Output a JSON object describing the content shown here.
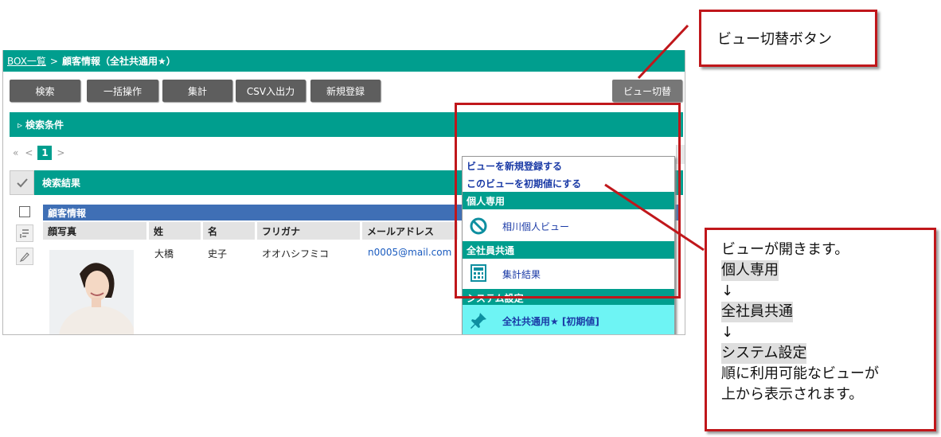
{
  "breadcrumb": {
    "link": "BOX一覧",
    "separator": ">",
    "current": "顧客情報（全社共通用★）"
  },
  "toolbar": {
    "search": "検索",
    "bulk": "一括操作",
    "aggregate": "集計",
    "csv": "CSV入出力",
    "new": "新規登録",
    "view_switch": "ビュー切替"
  },
  "search_conditions": {
    "arrow": "▹",
    "label": "検索条件"
  },
  "pager": {
    "first": "«",
    "prev": "<",
    "current": "1",
    "next": ">"
  },
  "results": {
    "label": "検索結果"
  },
  "table": {
    "group_label": "顧客情報",
    "columns": [
      "顔写真",
      "姓",
      "名",
      "フリガナ",
      "メールアドレス"
    ],
    "rows": [
      {
        "last_name": "大橋",
        "first_name": "史子",
        "kana": "オオハシフミコ",
        "email": "n0005@mail.com"
      }
    ]
  },
  "view_dropdown": {
    "link_new": "ビューを新規登録する",
    "link_default": "このビューを初期値にする",
    "groups": [
      {
        "label": "個人専用",
        "item": "相川個人ビュー",
        "icon": "prohibited-icon"
      },
      {
        "label": "全社員共通",
        "item": "集計結果",
        "icon": "calculator-icon"
      },
      {
        "label": "システム設定",
        "item": "全社共通用★ [初期値]",
        "icon": "pin-icon",
        "selected": true
      }
    ]
  },
  "annotations": {
    "top_callout": "ビュー切替ボタン",
    "right_callout": {
      "line1": "ビューが開きます。",
      "personal": "個人専用",
      "arrow1": "↓",
      "common": "全社員共通",
      "arrow2": "↓",
      "system": "システム設定",
      "line_order": "順に利用可能なビューが",
      "line_from_top": "上から表示されます。"
    }
  },
  "colors": {
    "teal": "#009e8e",
    "blue_header": "#3f6fb5",
    "highlight": "#6ef4f4",
    "annotation_red": "#c0171b"
  }
}
